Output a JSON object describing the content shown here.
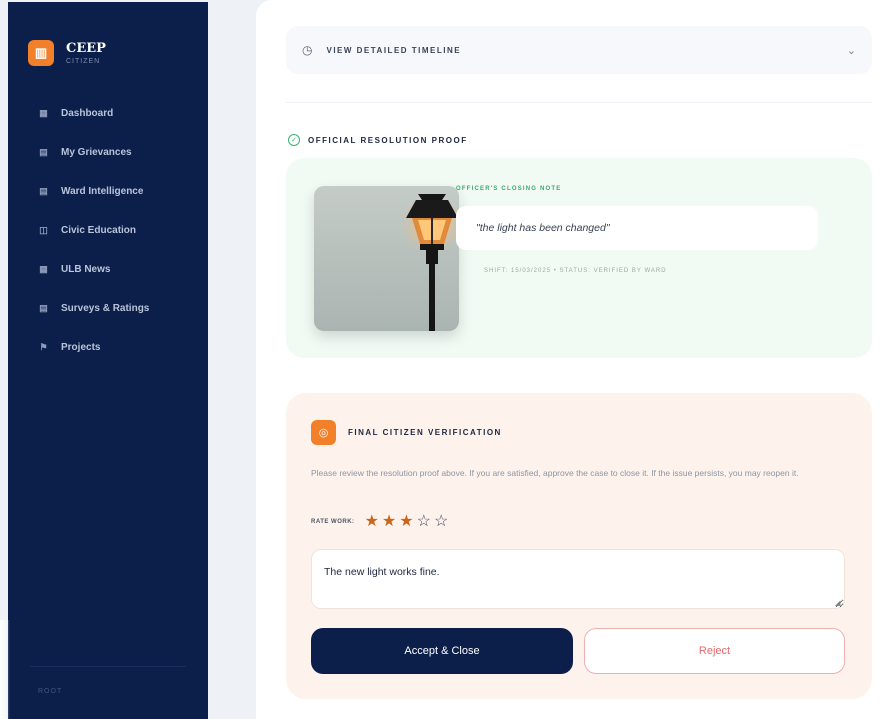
{
  "brand": {
    "name": "CEEP",
    "subtitle": "CITIZEN",
    "logo_icon": "building-icon",
    "logo_glyph": "▥"
  },
  "sidebar": {
    "items": [
      {
        "label": "Dashboard",
        "icon": "dashboard-icon",
        "glyph": "▦"
      },
      {
        "label": "My Grievances",
        "icon": "document-icon",
        "glyph": "▤"
      },
      {
        "label": "Ward Intelligence",
        "icon": "chart-doc-icon",
        "glyph": "▤"
      },
      {
        "label": "Civic Education",
        "icon": "book-icon",
        "glyph": "◫"
      },
      {
        "label": "ULB News",
        "icon": "news-icon",
        "glyph": "▦"
      },
      {
        "label": "Surveys & Ratings",
        "icon": "survey-icon",
        "glyph": "▤"
      },
      {
        "label": "Projects",
        "icon": "projects-icon",
        "glyph": "⚑"
      }
    ],
    "footer": "ROOT"
  },
  "timeline": {
    "label": "VIEW DETAILED TIMELINE",
    "icon": "clock-icon",
    "icon_glyph": "◷",
    "chevron_glyph": "⌄"
  },
  "proof": {
    "title": "OFFICIAL RESOLUTION PROOF",
    "check_glyph": "✓",
    "remark_label": "OFFICER'S CLOSING NOTE",
    "remark": "\"the light has been changed\"",
    "meta": "SHIFT: 15/03/2025   •   STATUS: VERIFIED BY WARD"
  },
  "verification": {
    "title": "FINAL CITIZEN VERIFICATION",
    "icon_glyph": "◎",
    "description": "Please review the resolution proof above. If you are satisfied, approve the case to close it. If the issue persists, you may reopen it.",
    "rate_label": "RATE WORK:",
    "rating": 3,
    "max_rating": 5,
    "comment": "The new light works fine.",
    "accept_label": "Accept & Close",
    "reject_label": "Reject"
  },
  "colors": {
    "sidebar": "#0c1f4a",
    "accent": "#f2802a",
    "success": "#35b46e",
    "reject": "#e36a6a"
  }
}
